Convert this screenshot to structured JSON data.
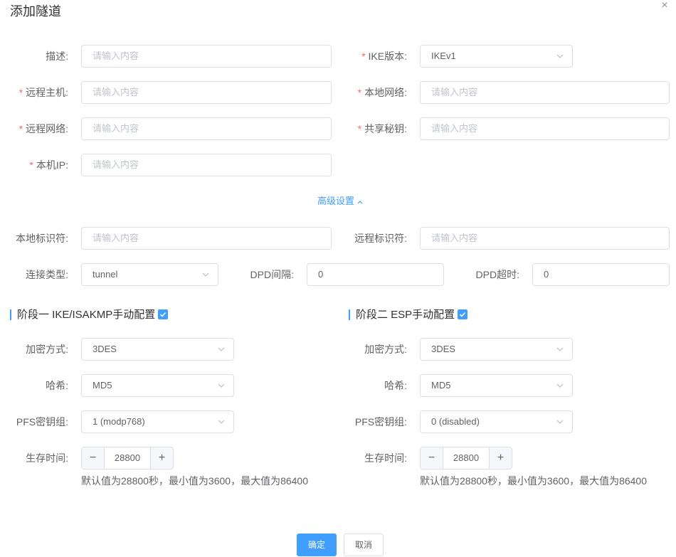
{
  "dialog": {
    "title": "添加隧道",
    "close_glyph": "×"
  },
  "placeholder": "请输入内容",
  "fields": {
    "description": {
      "label": "描述:"
    },
    "ike_version": {
      "label": "IKE版本:",
      "value": "IKEv1"
    },
    "remote_host": {
      "label": "远程主机:"
    },
    "local_network": {
      "label": "本地网络:"
    },
    "remote_network": {
      "label": "远程网络:"
    },
    "shared_key": {
      "label": "共享秘钥:"
    },
    "local_ip": {
      "label": "本机IP:"
    }
  },
  "required_mark": "*",
  "advanced": {
    "label": "高级设置"
  },
  "advanced_fields": {
    "local_id": {
      "label": "本地标识符:"
    },
    "remote_id": {
      "label": "远程标识符:"
    },
    "conn_type": {
      "label": "连接类型:",
      "value": "tunnel"
    },
    "dpd_interval": {
      "label": "DPD间隔:",
      "value": "0"
    },
    "dpd_timeout": {
      "label": "DPD超时:",
      "value": "0"
    }
  },
  "phase1": {
    "title": "阶段一 IKE/ISAKMP手动配置",
    "checked": true,
    "encryption": {
      "label": "加密方式:",
      "value": "3DES"
    },
    "hash": {
      "label": "哈希:",
      "value": "MD5"
    },
    "pfs": {
      "label": "PFS密钥组:",
      "value": "1 (modp768)"
    },
    "lifetime": {
      "label": "生存时间:",
      "value": "28800",
      "hint": "默认值为28800秒，最小值为3600，最大值为86400"
    }
  },
  "phase2": {
    "title": "阶段二 ESP手动配置",
    "checked": true,
    "encryption": {
      "label": "加密方式:",
      "value": "3DES"
    },
    "hash": {
      "label": "哈希:",
      "value": "MD5"
    },
    "pfs": {
      "label": "PFS密钥组:",
      "value": "0 (disabled)"
    },
    "lifetime": {
      "label": "生存时间:",
      "value": "28800",
      "hint": "默认值为28800秒，最小值为3600，最大值为86400"
    }
  },
  "stepper": {
    "minus": "−",
    "plus": "+"
  },
  "footer": {
    "confirm": "确定",
    "cancel": "取消"
  },
  "colors": {
    "primary": "#409eff",
    "required": "#f56c6c",
    "border": "#dcdfe6"
  }
}
